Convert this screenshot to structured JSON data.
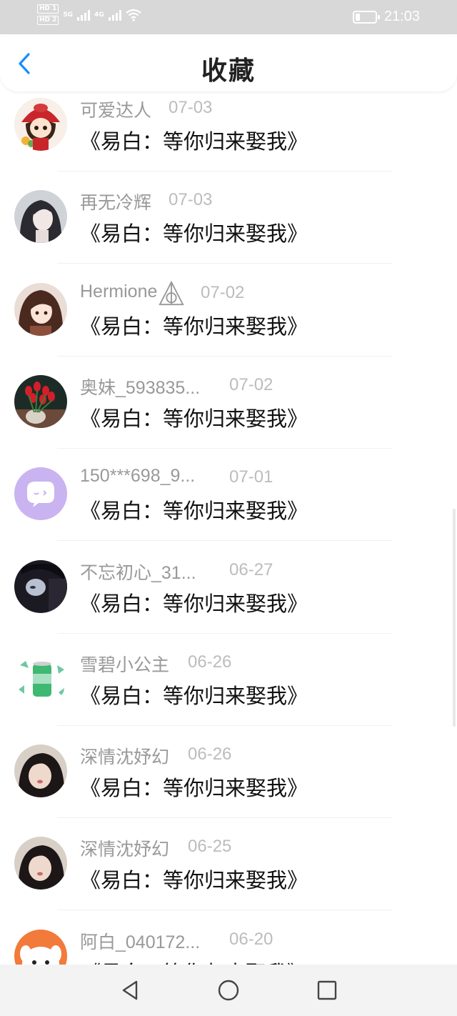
{
  "status_bar": {
    "hd1": "HD 1",
    "hd2": "HD 2",
    "net1": "5G",
    "net2": "4G",
    "battery_level": 0.25,
    "time": "21:03"
  },
  "header": {
    "title": "收藏",
    "back_icon": "chevron-left-icon",
    "accent_color": "#1a8cff"
  },
  "items": [
    {
      "name": "可爱达人",
      "date": "07-03",
      "book": "《易白：等你归来娶我》",
      "avatar_style": "girl-red-hat"
    },
    {
      "name": "再无冷辉",
      "date": "07-03",
      "book": "《易白：等你归来娶我》",
      "avatar_style": "anime-dark-hair"
    },
    {
      "name": "Hermione",
      "date": "07-02",
      "book": "《易白：等你归来娶我》",
      "avatar_style": "anime-brown-hair"
    },
    {
      "name": "奥妹_593835...",
      "date": "07-02",
      "book": "《易白：等你归来娶我》",
      "avatar_style": "red-tulips"
    },
    {
      "name": "150***698_9...",
      "date": "07-01",
      "book": "《易白：等你归来娶我》",
      "avatar_style": "default-chat-bubble"
    },
    {
      "name": "不忘初心_31...",
      "date": "06-27",
      "book": "《易白：等你归来娶我》",
      "avatar_style": "dark-portrait"
    },
    {
      "name": "雪碧小公主",
      "date": "06-26",
      "book": "《易白：等你归来娶我》",
      "avatar_style": "green-can"
    },
    {
      "name": "深情沈妤幻",
      "date": "06-26",
      "book": "《易白：等你归来娶我》",
      "avatar_style": "girl-photo"
    },
    {
      "name": "深情沈妤幻",
      "date": "06-25",
      "book": "《易白：等你归来娶我》",
      "avatar_style": "girl-photo"
    },
    {
      "name": "阿白_040172...",
      "date": "06-20",
      "book": "《易白：等你归来娶我》",
      "avatar_style": "orange-dog"
    }
  ],
  "nav": {
    "back": "triangle-back-icon",
    "home": "circle-home-icon",
    "recents": "square-recents-icon"
  }
}
